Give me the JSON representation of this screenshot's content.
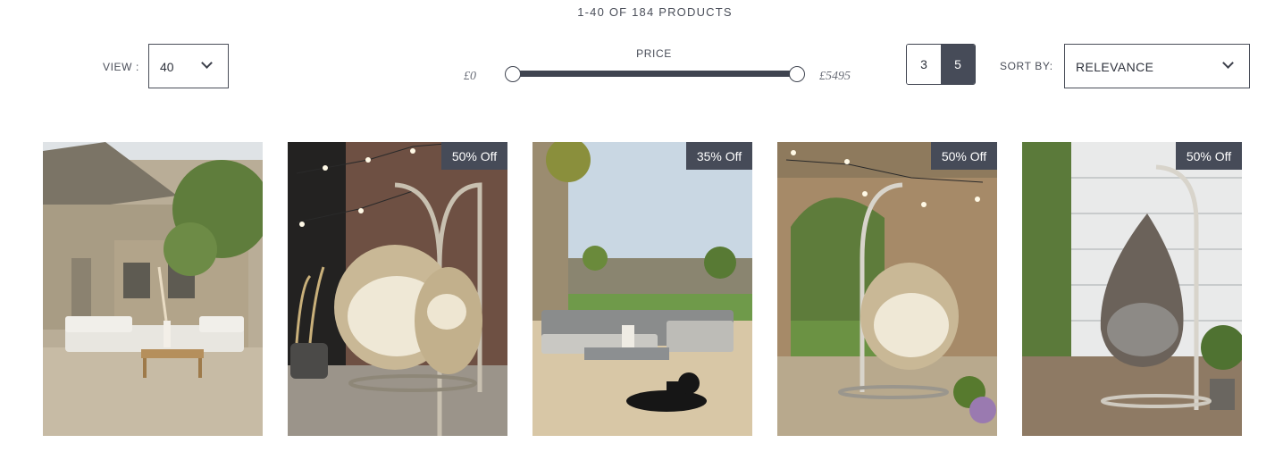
{
  "results": {
    "count_text": "1-40 OF 184 PRODUCTS"
  },
  "view": {
    "label": "VIEW :",
    "selected": "40"
  },
  "price": {
    "label": "PRICE",
    "min_label": "£0",
    "max_label": "£5495",
    "range_min_fraction": 0.0,
    "range_max_fraction": 1.0
  },
  "grid": {
    "options": [
      "3",
      "5"
    ],
    "active": "5"
  },
  "sort": {
    "label": "SORT BY:",
    "selected": "RELEVANCE"
  },
  "products": [
    {
      "badge": ""
    },
    {
      "badge": "50% Off"
    },
    {
      "badge": "35% Off"
    },
    {
      "badge": "50% Off"
    },
    {
      "badge": "50% Off"
    }
  ],
  "colors": {
    "accent": "#464b58",
    "border": "#4a4e59",
    "text": "#4a4e59"
  }
}
